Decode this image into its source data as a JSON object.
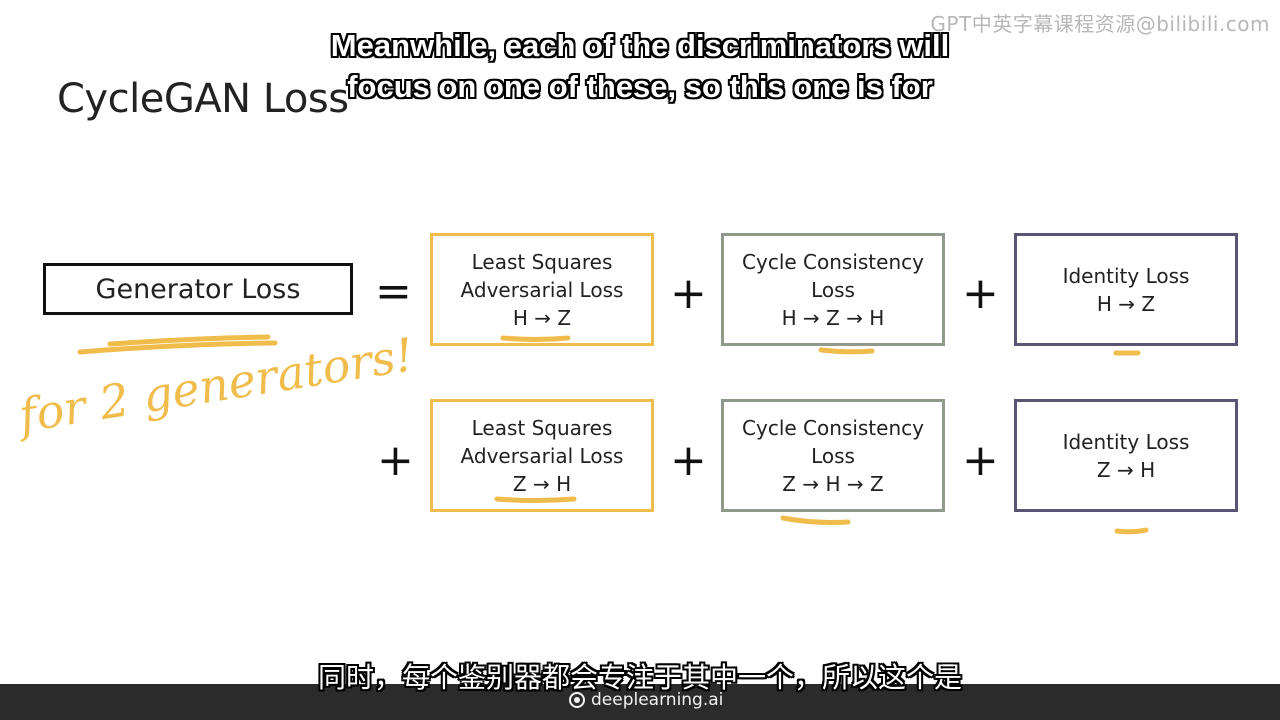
{
  "watermark": "GPT中英字幕课程资源@bilibili.com",
  "subtitles": {
    "en_line1": "Meanwhile, each of the discriminators will",
    "en_line2": "focus on one of these, so this one is for",
    "zh": "同时，每个鉴别器都会专注于其中一个，所以这个是"
  },
  "slide": {
    "title": "CycleGAN Loss",
    "generator_loss": "Generator Loss",
    "equals": "=",
    "plus": "+",
    "annotation": "for 2 generators!",
    "row1": {
      "adversarial": [
        "Least Squares",
        "Adversarial Loss",
        "H → Z"
      ],
      "cycle": [
        "Cycle Consistency",
        "Loss",
        "H → Z → H"
      ],
      "identity": [
        "Identity Loss",
        "H → Z"
      ]
    },
    "row2": {
      "adversarial": [
        "Least Squares",
        "Adversarial Loss",
        "Z → H"
      ],
      "cycle": [
        "Cycle Consistency",
        "Loss",
        "Z → H → Z"
      ],
      "identity": [
        "Identity Loss",
        "Z → H"
      ]
    }
  },
  "footer": {
    "brand": "deeplearning.ai"
  },
  "colors": {
    "adversarial_border": "#f0bd4c",
    "cycle_border": "#8f9a8d",
    "identity_border": "#5b5575",
    "ink": "#f0bd4c"
  }
}
